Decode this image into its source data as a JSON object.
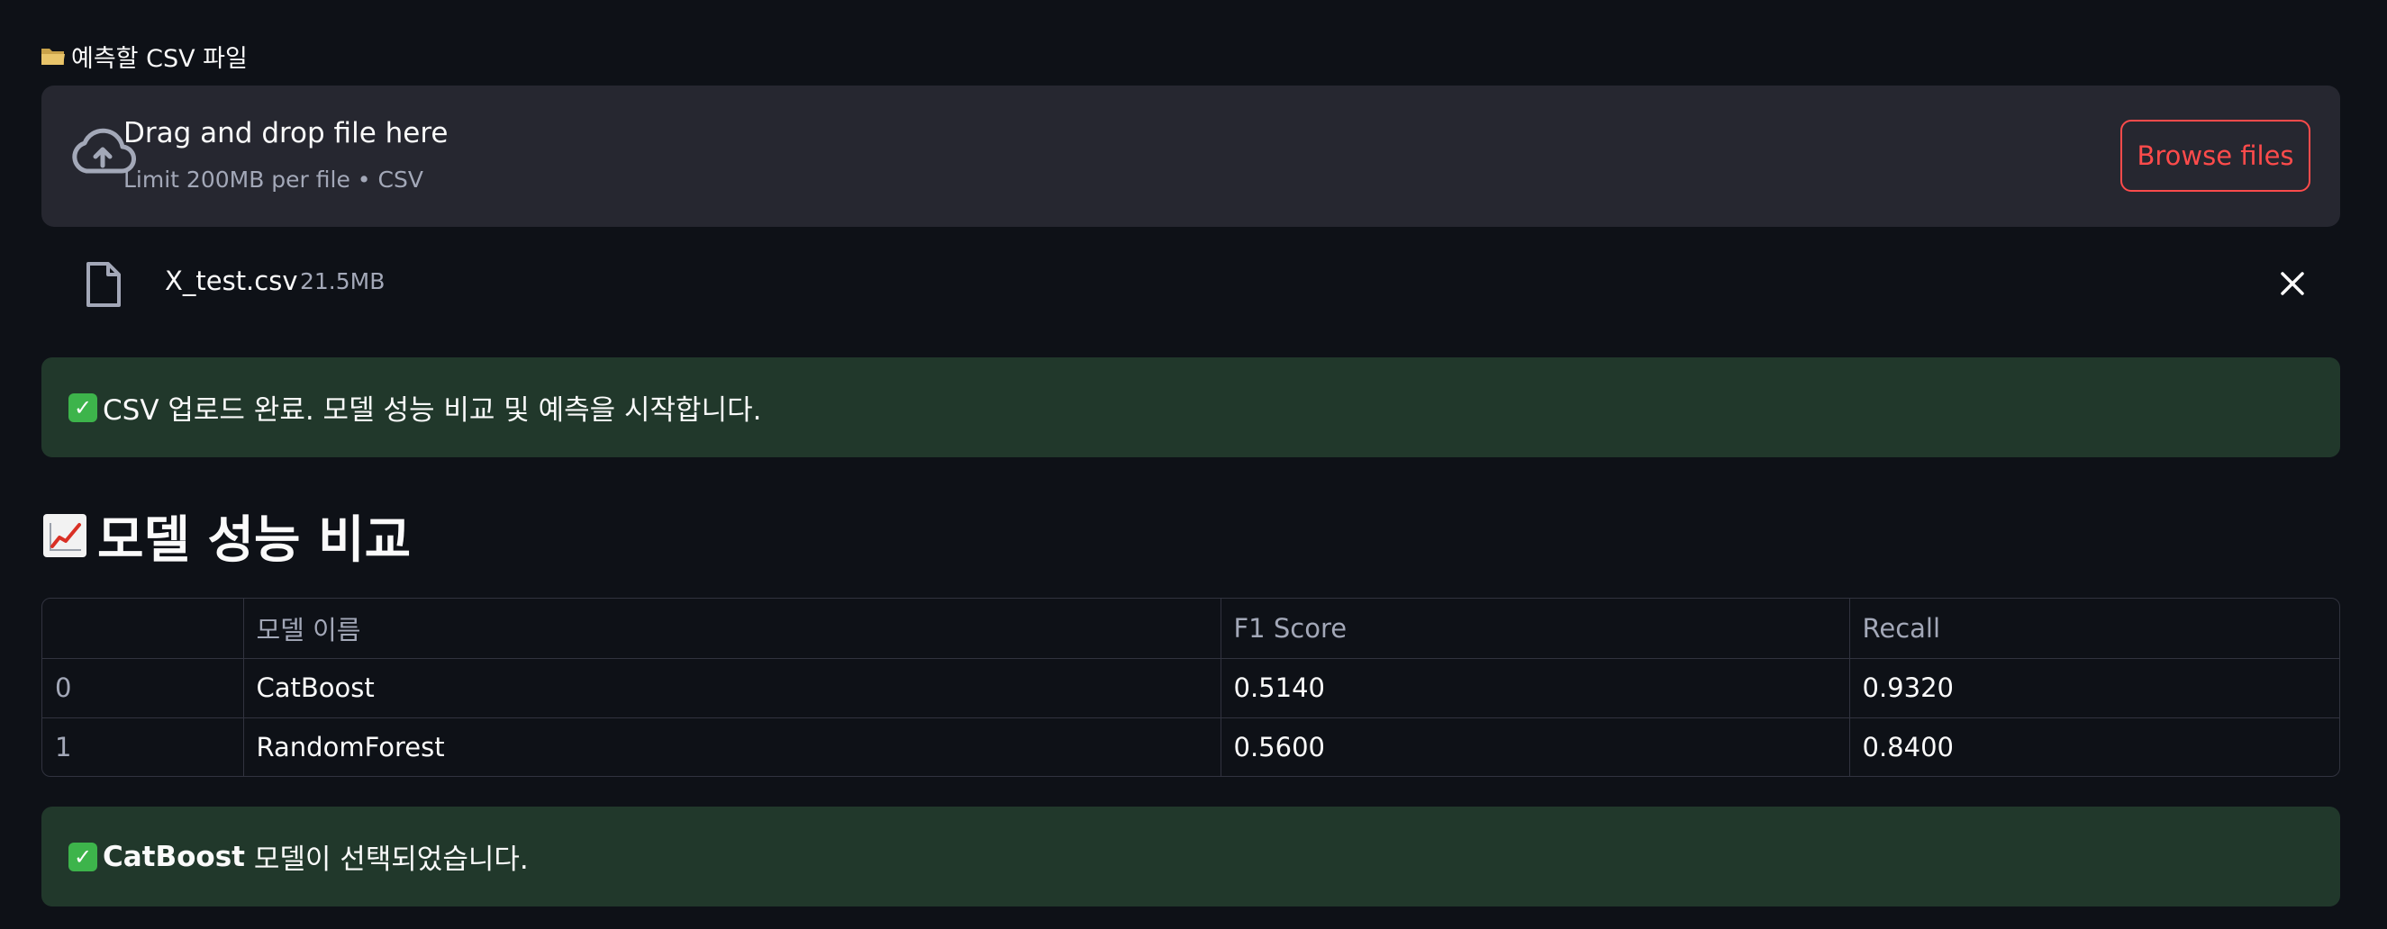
{
  "uploader": {
    "icon": "folder-icon",
    "label": "예측할 CSV 파일",
    "dropzone_title": "Drag and drop file here",
    "dropzone_subtitle": "Limit 200MB per file • CSV",
    "browse_label": "Browse files",
    "file_name": "X_test.csv",
    "file_size": "21.5MB"
  },
  "alerts": {
    "upload_done": "CSV 업로드 완료. 모델 성능 비교 및 예측을 시작합니다.",
    "selected_model": "CatBoost",
    "selected_suffix": " 모델이 선택되었습니다."
  },
  "section": {
    "icon": "chart-increasing-icon",
    "title": "모델 성능 비교"
  },
  "table": {
    "columns": [
      "",
      "모델 이름",
      "F1 Score",
      "Recall"
    ],
    "rows": [
      [
        "0",
        "CatBoost",
        "0.5140",
        "0.9320"
      ],
      [
        "1",
        "RandomForest",
        "0.5600",
        "0.8400"
      ]
    ]
  },
  "colors": {
    "background": "#0e1117",
    "accent": "#ff4b4b",
    "success_bg": "#21382b"
  }
}
